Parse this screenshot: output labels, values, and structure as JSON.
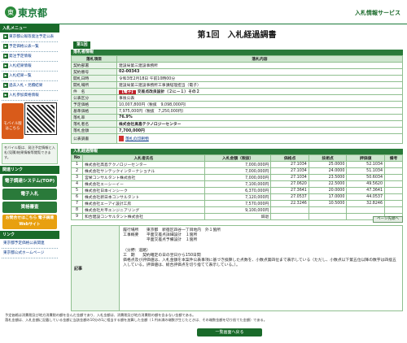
{
  "header": {
    "logo_emblem": "東",
    "logo_text": "東京都",
    "service_title": "入札情報サービス"
  },
  "sidebar": {
    "section_menu": "入札メニュー",
    "items": [
      "東京都公報等発注予定公表",
      "予定価格公表一覧",
      "発注予定情報",
      "入札結果情報",
      "入札結果一覧",
      "過去入札・見積結果",
      "入札参加資格情報"
    ],
    "mobile_label": "モバイル版",
    "mobile_sub": "はこちら",
    "mobile_note": "モバイル版は、発注予定情報と入札(見積)結果情報等閲覧できます。",
    "section_links": "関連リンク",
    "btn_system": "電子調達システム(TOP)",
    "btn_ebid": "電子入札",
    "btn_register": "資格審査",
    "btn_qa": "お問合せはこちら 電子調達Webサイト",
    "links_header": "リンク",
    "link1": "東京都予定価格公表関連",
    "link2": "東京都公式ホームページ"
  },
  "main": {
    "title": "第1回　入札経過調書",
    "round_tab": "第1回",
    "section_info": "落札者情報",
    "info_headers": [
      "落札項目",
      "落札内容"
    ],
    "info": [
      {
        "k": "契約部署",
        "v": "建設局第三建設事務所"
      },
      {
        "k": "契約番号",
        "v": "02-00343"
      },
      {
        "k": "開札日時",
        "v": "令和3年2月18日 午前10時00分"
      },
      {
        "k": "開札場所",
        "v": "建設局第三建設事務所工事課経理担当（電子）"
      },
      {
        "k": "件　名",
        "tag": "【電子】",
        "v": "交差点改良設計（２に－１）その２"
      },
      {
        "k": "公表区分",
        "v": "事後公表"
      },
      {
        "k": "予定価格",
        "v": "10,007,800円（税抜　9,098,000円）"
      },
      {
        "k": "基準価格",
        "v": "7,975,000円（税抜　7,250,000円）"
      },
      {
        "k": "落札率",
        "v": "76.9%"
      },
      {
        "k": "落札者名",
        "v": "株式会社高島テクノロジーセンター"
      },
      {
        "k": "落札金額",
        "v": "7,700,000円"
      },
      {
        "k": "公表調書",
        "v": "落札の印刷物"
      }
    ],
    "section_bid": "入札経過情報",
    "bid_headers": [
      "No",
      "入札者氏名",
      "入札金額（税抜）",
      "価格点",
      "技術点",
      "評価値",
      "備考"
    ],
    "bids": [
      {
        "no": "1",
        "name": "株式会社高島テクノロジーセンター",
        "amount": "7,000,000円",
        "price": "27.1034",
        "tech": "25.0000",
        "eval": "52.1034",
        "note": ""
      },
      {
        "no": "2",
        "name": "株式会社サンテックインターナショナル",
        "amount": "7,000,000円",
        "price": "27.1034",
        "tech": "24.0000",
        "eval": "51.1034",
        "note": ""
      },
      {
        "no": "3",
        "name": "宮栄コンサルタント株式会社",
        "amount": "7,000,000円",
        "price": "27.1034",
        "tech": "23.5000",
        "eval": "50.6034",
        "note": ""
      },
      {
        "no": "4",
        "name": "株式会社エーシーイー",
        "amount": "7,100,000円",
        "price": "27.0620",
        "tech": "22.5000",
        "eval": "49.5620",
        "note": ""
      },
      {
        "no": "5",
        "name": "株式会社日本インシーク",
        "amount": "6,370,000円",
        "price": "27.3641",
        "tech": "20.0000",
        "eval": "47.3641",
        "note": ""
      },
      {
        "no": "6",
        "name": "株式会社新日本コンサルタント",
        "amount": "7,120,000円",
        "price": "27.0537",
        "tech": "17.0000",
        "eval": "44.0537",
        "note": ""
      },
      {
        "no": "7",
        "name": "株式会社エーアイ設計工房",
        "amount": "7,570,000円",
        "price": "22.3246",
        "tech": "10.5000",
        "eval": "32.8246",
        "note": ""
      },
      {
        "no": "8",
        "name": "株式会社片平エンジニアリング",
        "amount": "9,100,000円",
        "price": "",
        "tech": "",
        "eval": "",
        "note": ""
      },
      {
        "no": "9",
        "name": "和合建設コンサルタント株式会社",
        "amount": "辞退",
        "price": "",
        "tech": "",
        "eval": "",
        "note": ""
      }
    ],
    "back_top": "ページ先頭へ",
    "remarks_label": "記事",
    "remarks_text": "履行場所　　東京都　新宿区四谷一丁目地内　外１箇所\n工事概要　　平面交差点詳細設計　１箇所\n　　　　　　平面交差点予備設計　１箇所\n\n（分野：道路）\n工　期　　契約確定の日の翌日から150日間\n価格点及び評価値は、入札金額を本案件公表事項に基づき換算した点数を、小数点第四位まで表示している（ただし、小数点以下第五位以降の数字は四捨五入している。評価値は、総合評価点を切り捨てて表示している。）。",
    "footnote": "予定価格は消費税及び地方消費税の額を含んだ金額であり、入札金額は、消費税及び地方消費税の額を含まない金額である。\n落札金額は、入札金額に記載している金額に当該金額の10分の1に相当する額を加算した金額（１円未満の端数が生じたときは、その端数金額を切り捨てた金額）である。",
    "back_list": "一覧画面へ戻る"
  }
}
